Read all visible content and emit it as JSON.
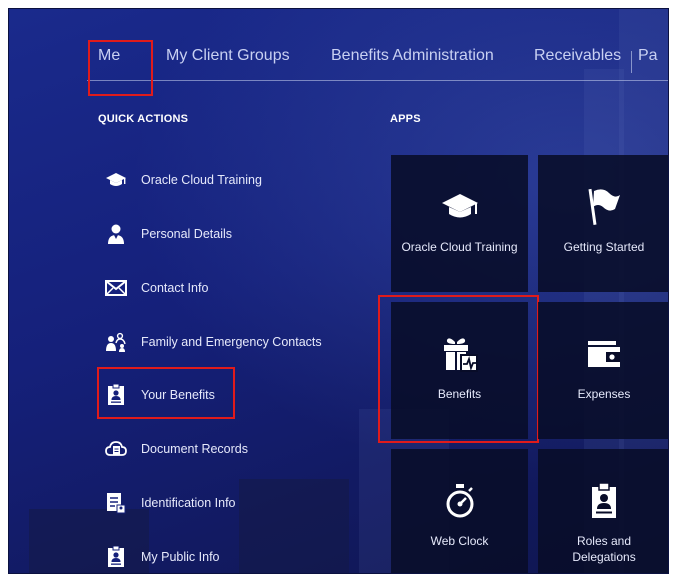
{
  "nav": {
    "tabs": [
      {
        "label": "Me"
      },
      {
        "label": "My Client Groups"
      },
      {
        "label": "Benefits Administration"
      },
      {
        "label": "Receivables"
      },
      {
        "label": "Pa"
      }
    ]
  },
  "quick_actions": {
    "title": "QUICK ACTIONS",
    "items": [
      {
        "label": "Oracle Cloud Training",
        "icon": "graduation-cap-icon"
      },
      {
        "label": "Personal Details",
        "icon": "person-icon"
      },
      {
        "label": "Contact Info",
        "icon": "envelope-icon"
      },
      {
        "label": "Family and Emergency Contacts",
        "icon": "family-icon"
      },
      {
        "label": "Your Benefits",
        "icon": "benefits-badge-icon"
      },
      {
        "label": "Document Records",
        "icon": "cloud-document-icon"
      },
      {
        "label": "Identification Info",
        "icon": "id-document-icon"
      },
      {
        "label": "My Public Info",
        "icon": "badge-icon"
      }
    ]
  },
  "apps": {
    "title": "APPS",
    "tiles": [
      {
        "label": "Oracle Cloud Training",
        "icon": "graduation-cap-icon"
      },
      {
        "label": "Getting Started",
        "icon": "flag-icon"
      },
      {
        "label": "Benefits",
        "icon": "gift-icon"
      },
      {
        "label": "Expenses",
        "icon": "wallet-icon"
      },
      {
        "label": "Web Clock",
        "icon": "stopwatch-icon"
      },
      {
        "label": "Roles and Delegations",
        "icon": "badge-icon"
      }
    ]
  },
  "colors": {
    "background": "#15207a",
    "tile": "#080c28",
    "highlight": "#e01b1b",
    "text": "#e6e9fb"
  }
}
